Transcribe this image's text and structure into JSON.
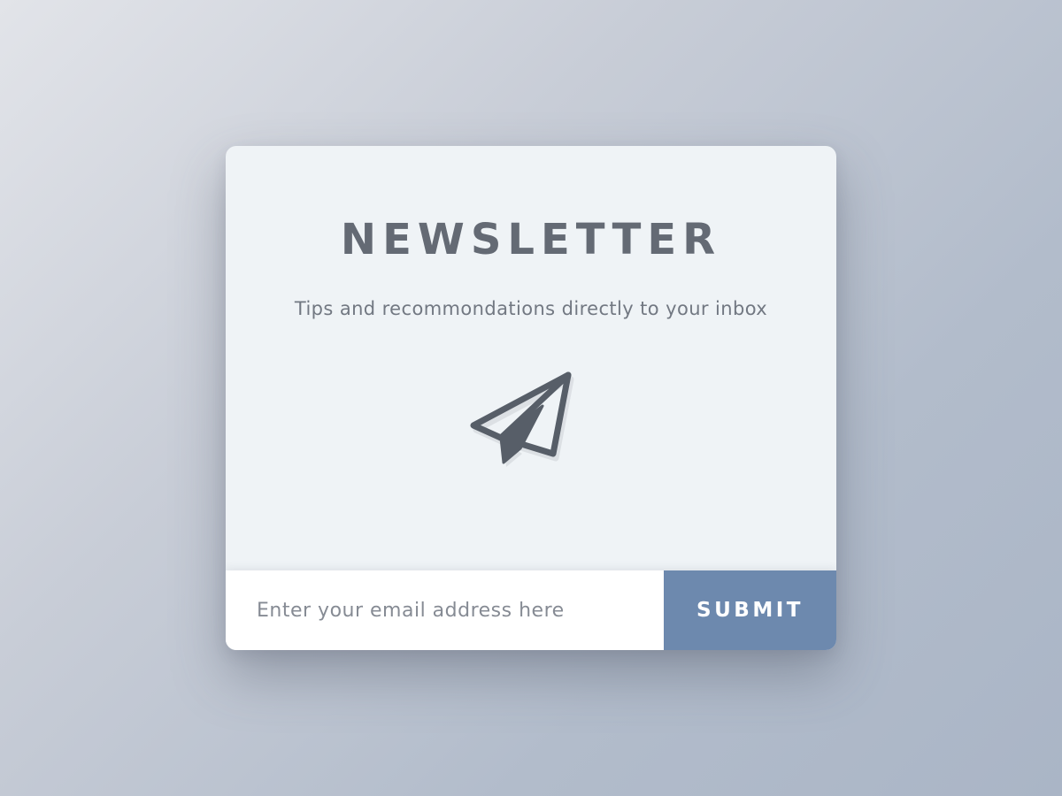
{
  "newsletter": {
    "title": "NEWSLETTER",
    "subtitle": "Tips and recommondations directly to your inbox",
    "icon": "paper-plane-icon",
    "email_placeholder": "Enter your email address here",
    "email_value": "",
    "submit_label": "SUBMIT"
  },
  "colors": {
    "card_background": "#eff3f6",
    "title_text": "#646a74",
    "icon": "#575e68",
    "submit_button": "#6d89ae",
    "submit_text": "#ffffff"
  }
}
